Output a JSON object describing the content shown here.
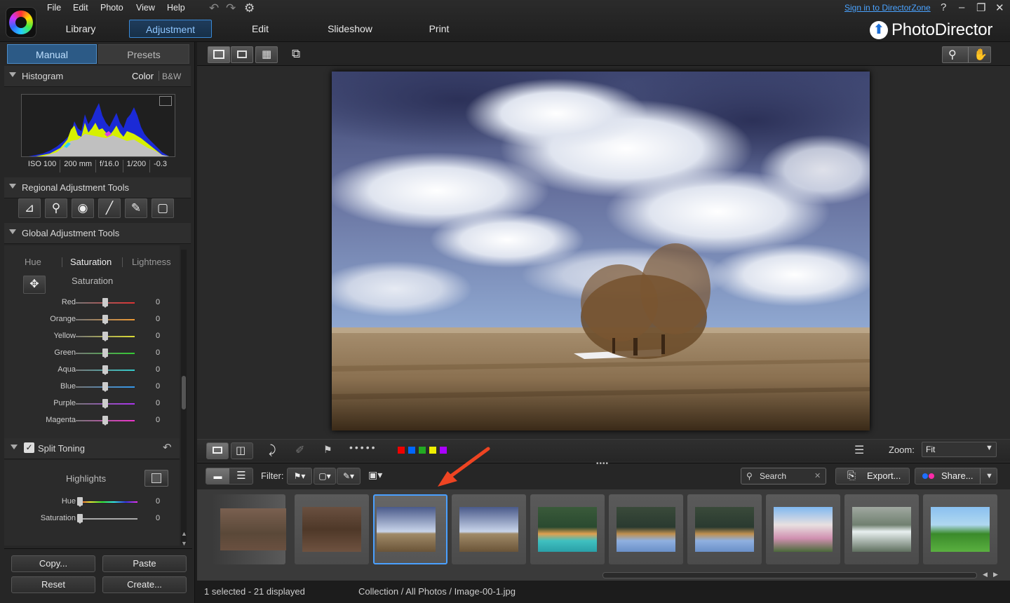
{
  "menu": [
    "File",
    "Edit",
    "Photo",
    "View",
    "Help"
  ],
  "top_links": {
    "sign_in": "Sign in to DirectorZone",
    "help": "?"
  },
  "window_controls": {
    "minimize": "–",
    "restore": "❐",
    "close": "✕"
  },
  "brand": "PhotoDirector",
  "main_tabs": [
    "Library",
    "Adjustment",
    "Edit",
    "Slideshow",
    "Print"
  ],
  "left_tabs": {
    "manual": "Manual",
    "presets": "Presets"
  },
  "histogram": {
    "title": "Histogram",
    "mode_color": "Color",
    "mode_bw": "B&W",
    "info": [
      "ISO 100",
      "200 mm",
      "f/16.0",
      "1/200",
      "-0.3"
    ]
  },
  "regional": {
    "title": "Regional Adjustment Tools"
  },
  "global": {
    "title": "Global Adjustment Tools"
  },
  "hsl": {
    "tabs": [
      "Hue",
      "Saturation",
      "Lightness"
    ],
    "subtitle": "Saturation",
    "rows": [
      {
        "label": "Red",
        "value": "0",
        "color": "#d33"
      },
      {
        "label": "Orange",
        "value": "0",
        "color": "#e93"
      },
      {
        "label": "Yellow",
        "value": "0",
        "color": "#dd3"
      },
      {
        "label": "Green",
        "value": "0",
        "color": "#3c3"
      },
      {
        "label": "Aqua",
        "value": "0",
        "color": "#3cc"
      },
      {
        "label": "Blue",
        "value": "0",
        "color": "#39e"
      },
      {
        "label": "Purple",
        "value": "0",
        "color": "#a3e"
      },
      {
        "label": "Magenta",
        "value": "0",
        "color": "#e3c"
      }
    ]
  },
  "split_toning": {
    "title": "Split Toning",
    "highlights": "Highlights",
    "rows": [
      {
        "label": "Hue",
        "value": "0"
      },
      {
        "label": "Saturation",
        "value": "0"
      }
    ]
  },
  "bottom_buttons": {
    "copy": "Copy...",
    "paste": "Paste",
    "reset": "Reset",
    "create": "Create..."
  },
  "toolbar": {
    "zoom_label": "Zoom:",
    "zoom_value": "Fit",
    "color_labels": [
      "#e00",
      "#06f",
      "#2a2",
      "#ee0",
      "#a0f"
    ]
  },
  "filter": {
    "label": "Filter:"
  },
  "search": {
    "placeholder": "Search"
  },
  "export_label": "Export...",
  "share_label": "Share...",
  "status": {
    "selection": "1 selected - 21 displayed",
    "path": "Collection / All Photos / Image-00-1.jpg"
  }
}
